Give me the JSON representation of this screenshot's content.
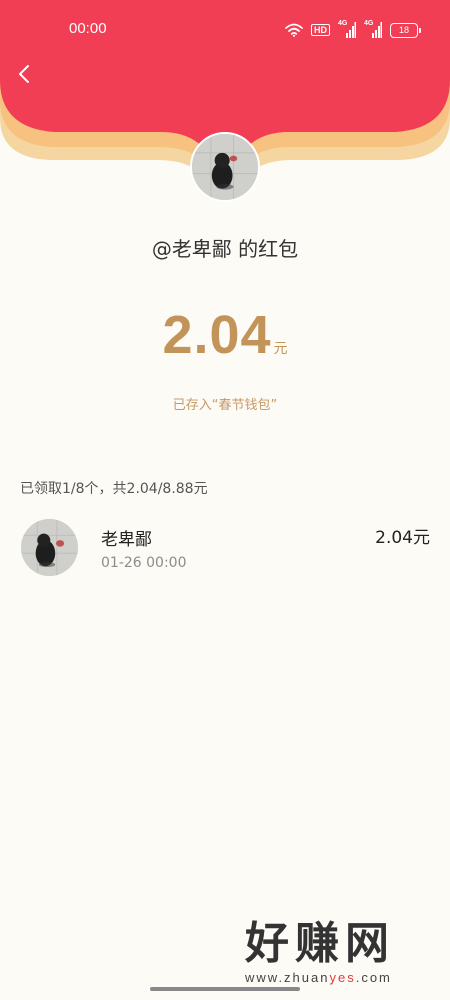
{
  "status_bar": {
    "time": "00:00",
    "hd_label": "HD",
    "net_label_1": "4G",
    "net_label_2": "4G",
    "battery": "18"
  },
  "envelope": {
    "sender_title": "@老卑鄙 的红包",
    "amount": "2.04",
    "amount_unit": "元",
    "stored_note": "已存入“春节钱包”",
    "summary": "已领取1/8个，共2.04/8.88元"
  },
  "receivers": [
    {
      "name": "老卑鄙",
      "time": "01-26 00:00",
      "amount": "2.04元"
    }
  ],
  "watermark": {
    "text": "好赚网",
    "url_prefix": "www.zhuan",
    "url_highlight": "yes",
    "url_suffix": ".com"
  },
  "colors": {
    "header_red": "#F23E55",
    "header_gold": "#F6D6A0",
    "amount_gold": "#C29459",
    "background": "#FCFBF6"
  },
  "icons": {
    "back": "chevron-left-icon",
    "wifi": "wifi-icon",
    "signal": "signal-icon",
    "battery": "battery-icon"
  }
}
